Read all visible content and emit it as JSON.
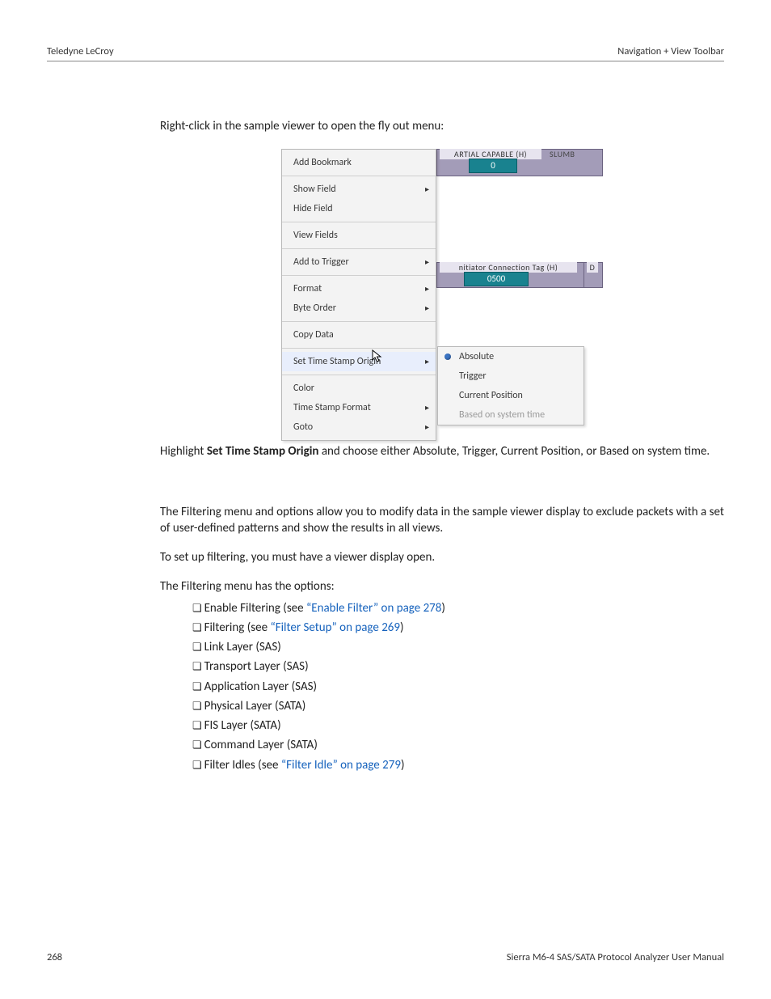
{
  "header": {
    "left": "Teledyne LeCroy",
    "right": "Navigation + View Toolbar"
  },
  "footer": {
    "page": "268",
    "doc": "Sierra M6-4 SAS/SATA Protocol Analyzer User Manual"
  },
  "intro": "Right-click in the sample viewer to open the fly out menu:",
  "highlight": {
    "pre": "Highlight ",
    "bold": "Set Time Stamp Origin",
    "post": " and choose either Absolute, Trigger, Current Position, or Based on system time."
  },
  "filter": {
    "p1": "The Filtering menu and options allow you to modify data in the sample viewer display to exclude packets with a set of user-defined patterns and show the results in all views.",
    "p2": "To set up filtering, you must have a viewer display open.",
    "p3": "The Filtering menu has the options:"
  },
  "bullets": [
    {
      "pre": "Enable Filtering (see ",
      "link": "“Enable Filter” on page 278",
      "post": ")"
    },
    {
      "pre": "Filtering (see ",
      "link": "“Filter Setup” on page 269",
      "post": ")"
    },
    {
      "label": "Link Layer (SAS)"
    },
    {
      "label": "Transport Layer (SAS)"
    },
    {
      "label": "Application Layer (SAS)"
    },
    {
      "label": "Physical Layer (SATA)"
    },
    {
      "label": "FIS Layer (SATA)"
    },
    {
      "label": "Command Layer (SATA)"
    },
    {
      "pre": "Filter Idles (see ",
      "link": "“Filter Idle” on page 279",
      "post": ")"
    }
  ],
  "ctx": {
    "items": [
      "Add Bookmark",
      "Show Field",
      "Hide Field",
      "View Fields",
      "Add to Trigger",
      "Format",
      "Byte Order",
      "Copy Data",
      "Set Time Stamp Origin",
      "Color",
      "Time Stamp Format",
      "Goto"
    ],
    "sub": [
      "Absolute",
      "Trigger",
      "Current Position",
      "Based on system time"
    ]
  },
  "bg": {
    "top_header": "ARTIAL CAPABLE (H)",
    "slumb": "SLUMB",
    "top_val": "0",
    "mid_header": "nitiator Connection Tag (H)",
    "mid_right": "D",
    "mid_val": "0500"
  }
}
